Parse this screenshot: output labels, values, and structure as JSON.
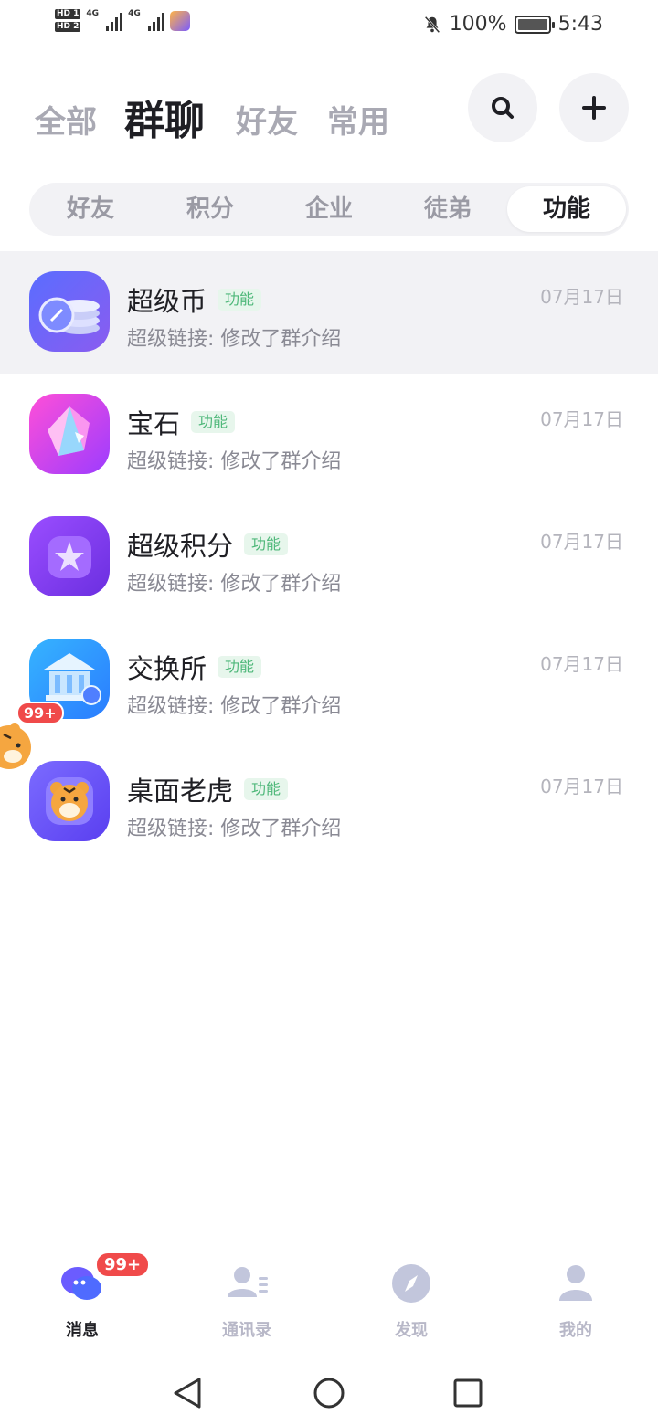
{
  "status_bar": {
    "hd1": "HD 1",
    "hd2": "HD 2",
    "net1": "4G",
    "net2": "4G",
    "battery": "100%",
    "time": "5:43"
  },
  "header": {
    "tabs": [
      {
        "label": "全部"
      },
      {
        "label": "群聊"
      },
      {
        "label": "好友"
      },
      {
        "label": "常用"
      }
    ],
    "active_tab": "群聊"
  },
  "subtabs": {
    "items": [
      {
        "label": "好友"
      },
      {
        "label": "积分"
      },
      {
        "label": "企业"
      },
      {
        "label": "徒弟"
      },
      {
        "label": "功能"
      }
    ],
    "active": "功能"
  },
  "chats": [
    {
      "name": "超级币",
      "tag": "功能",
      "preview": "超级链接: 修改了群介绍",
      "time": "07月17日",
      "icon": "coins-icon"
    },
    {
      "name": "宝石",
      "tag": "功能",
      "preview": "超级链接: 修改了群介绍",
      "time": "07月17日",
      "icon": "gem-icon"
    },
    {
      "name": "超级积分",
      "tag": "功能",
      "preview": "超级链接: 修改了群介绍",
      "time": "07月17日",
      "icon": "star-points-icon"
    },
    {
      "name": "交换所",
      "tag": "功能",
      "preview": "超级链接: 修改了群介绍",
      "time": "07月17日",
      "icon": "bank-icon"
    },
    {
      "name": "桌面老虎",
      "tag": "功能",
      "preview": "超级链接: 修改了群介绍",
      "time": "07月17日",
      "icon": "tiger-icon"
    }
  ],
  "floating": {
    "badge": "99+"
  },
  "bottom_nav": {
    "items": [
      {
        "label": "消息",
        "icon": "message-icon"
      },
      {
        "label": "通讯录",
        "icon": "contacts-icon"
      },
      {
        "label": "发现",
        "icon": "compass-icon"
      },
      {
        "label": "我的",
        "icon": "profile-icon"
      }
    ],
    "message_badge": "99+"
  },
  "colors": {
    "accent": "#6b5cff",
    "tag_green": "#4fb87a",
    "badge_red": "#f04a4a"
  }
}
